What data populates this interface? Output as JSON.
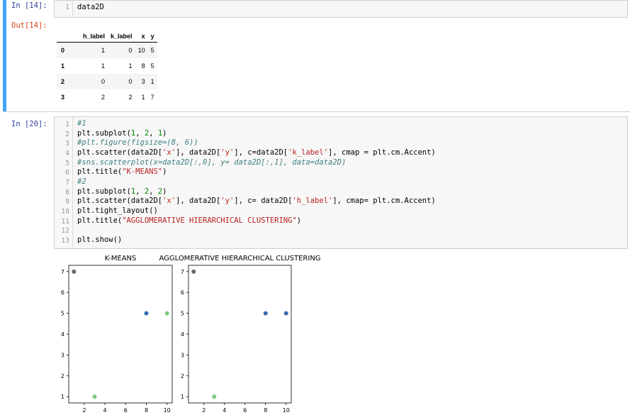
{
  "cell14": {
    "in_prompt": "In [14]:",
    "line_numbers": [
      "1"
    ],
    "code": "data2D",
    "out_prompt": "Out[14]:",
    "table": {
      "columns": [
        "h_label",
        "k_label",
        "x",
        "y"
      ],
      "rows": [
        {
          "index": "0",
          "values": [
            "1",
            "0",
            "10",
            "5"
          ]
        },
        {
          "index": "1",
          "values": [
            "1",
            "1",
            "8",
            "5"
          ]
        },
        {
          "index": "2",
          "values": [
            "0",
            "0",
            "3",
            "1"
          ]
        },
        {
          "index": "3",
          "values": [
            "2",
            "2",
            "1",
            "7"
          ]
        }
      ]
    }
  },
  "cell20": {
    "in_prompt": "In [20]:",
    "line_numbers": [
      "1",
      "2",
      "3",
      "4",
      "5",
      "6",
      "7",
      "8",
      "9",
      "10",
      "11",
      "12",
      "13"
    ]
  },
  "chart_data": [
    {
      "type": "scatter",
      "title": "K-MEANS",
      "xticks": [
        "2",
        "4",
        "6",
        "8",
        "10"
      ],
      "yticks": [
        "1",
        "2",
        "3",
        "4",
        "5",
        "6",
        "7"
      ],
      "xlim": [
        0.5,
        10.5
      ],
      "ylim": [
        0.7,
        7.3
      ],
      "points": [
        {
          "x": 10,
          "y": 5,
          "color": "#7fc97f"
        },
        {
          "x": 8,
          "y": 5,
          "color": "#386cb0"
        },
        {
          "x": 3,
          "y": 1,
          "color": "#7fc97f"
        },
        {
          "x": 1,
          "y": 7,
          "color": "#666666"
        }
      ]
    },
    {
      "type": "scatter",
      "title": "AGGLOMERATIVE HIERARCHICAL CLUSTERING",
      "xticks": [
        "2",
        "4",
        "6",
        "8",
        "10"
      ],
      "yticks": [
        "1",
        "2",
        "3",
        "4",
        "5",
        "6",
        "7"
      ],
      "xlim": [
        0.5,
        10.5
      ],
      "ylim": [
        0.7,
        7.3
      ],
      "points": [
        {
          "x": 10,
          "y": 5,
          "color": "#386cb0"
        },
        {
          "x": 8,
          "y": 5,
          "color": "#386cb0"
        },
        {
          "x": 3,
          "y": 1,
          "color": "#7fc97f"
        },
        {
          "x": 1,
          "y": 7,
          "color": "#666666"
        }
      ]
    }
  ],
  "colors": {
    "selected_cell_bar": "#42a5f5",
    "in_prompt": "#303f9f",
    "out_prompt": "#d84315",
    "string": "#ba2121",
    "comment": "#408080"
  }
}
